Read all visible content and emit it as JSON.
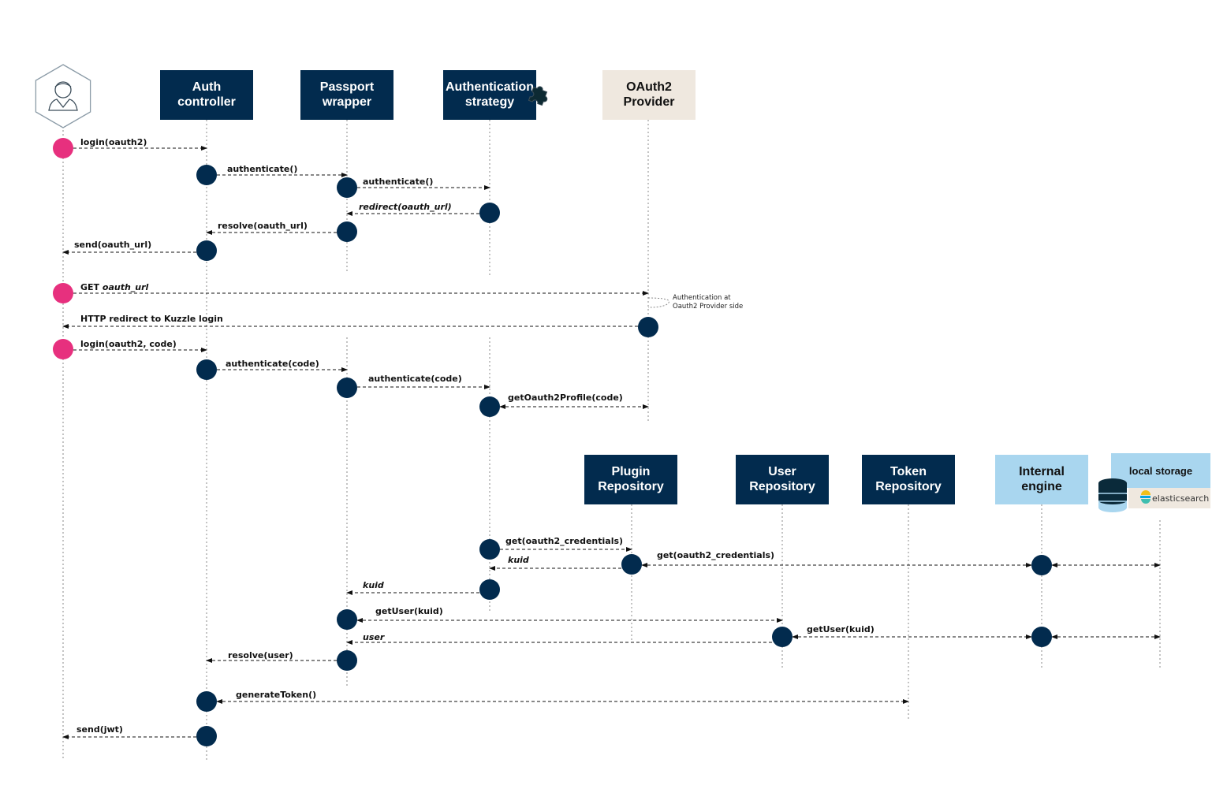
{
  "colors": {
    "navy": "#022b4e",
    "pink": "#e7307e",
    "beige": "#efe8df",
    "light_blue": "#a9d6ef",
    "line": "#888888",
    "arrow": "#111111"
  },
  "participants": [
    {
      "id": "user",
      "label": "",
      "icon": "user-avatar-icon",
      "style": "actor"
    },
    {
      "id": "auth_controller",
      "label": "Auth\ncontroller",
      "style": "navy"
    },
    {
      "id": "passport_wrapper",
      "label": "Passport\nwrapper",
      "style": "navy"
    },
    {
      "id": "auth_strategy",
      "label": "Authentication\nstrategy",
      "style": "navy",
      "icon": "puzzle-piece-icon"
    },
    {
      "id": "oauth2_provider",
      "label": "OAuth2\nProvider",
      "style": "beige"
    },
    {
      "id": "plugin_repository",
      "label": "Plugin\nRepository",
      "style": "navy"
    },
    {
      "id": "user_repository",
      "label": "User\nRepository",
      "style": "navy"
    },
    {
      "id": "token_repository",
      "label": "Token\nRepository",
      "style": "navy"
    },
    {
      "id": "internal_engine",
      "label": "Internal\nengine",
      "style": "light"
    },
    {
      "id": "local_storage",
      "label": "local storage",
      "style": "light",
      "sublabel": "elasticsearch",
      "icon": "database-icon"
    }
  ],
  "messages": [
    {
      "from": "user",
      "to": "auth_controller",
      "label": "login(oauth2)",
      "italic": false
    },
    {
      "from": "auth_controller",
      "to": "passport_wrapper",
      "label": "authenticate()",
      "italic": false
    },
    {
      "from": "passport_wrapper",
      "to": "auth_strategy",
      "label": "authenticate()",
      "italic": false
    },
    {
      "from": "auth_strategy",
      "to": "passport_wrapper",
      "label": "redirect(oauth_url)",
      "italic": true
    },
    {
      "from": "passport_wrapper",
      "to": "auth_controller",
      "label": "resolve(oauth_url)",
      "italic": false
    },
    {
      "from": "auth_controller",
      "to": "user",
      "label": "send(oauth_url)",
      "italic": false
    },
    {
      "from": "user",
      "to": "oauth2_provider",
      "label_prefix": "GET ",
      "label": "oauth_url",
      "italic": true
    },
    {
      "from": "oauth2_provider",
      "to": "user",
      "label": "HTTP redirect to Kuzzle login",
      "italic": false
    },
    {
      "from": "user",
      "to": "auth_controller",
      "label": "login(oauth2, code)",
      "italic": false
    },
    {
      "from": "auth_controller",
      "to": "passport_wrapper",
      "label": "authenticate(code)",
      "italic": false
    },
    {
      "from": "passport_wrapper",
      "to": "auth_strategy",
      "label": "authenticate(code)",
      "italic": false
    },
    {
      "from": "auth_strategy",
      "to": "oauth2_provider",
      "label": "getOauth2Profile(code)",
      "italic": false,
      "bidirectional": true
    },
    {
      "from": "auth_strategy",
      "to": "plugin_repository",
      "label": "get(oauth2_credentials)",
      "italic": false
    },
    {
      "from": "plugin_repository",
      "to": "internal_engine",
      "label": "get(oauth2_credentials)",
      "italic": false,
      "bidirectional": true
    },
    {
      "from": "internal_engine",
      "to": "local_storage",
      "label": "",
      "bidirectional": true
    },
    {
      "from": "plugin_repository",
      "to": "auth_strategy",
      "label": "kuid",
      "italic": true
    },
    {
      "from": "auth_strategy",
      "to": "passport_wrapper",
      "label": "kuid",
      "italic": true
    },
    {
      "from": "passport_wrapper",
      "to": "user_repository",
      "label": "getUser(kuid)",
      "italic": false,
      "bidirectional": true
    },
    {
      "from": "user_repository",
      "to": "passport_wrapper",
      "label": "user",
      "italic": true
    },
    {
      "from": "user_repository",
      "to": "internal_engine",
      "label": "getUser(kuid)",
      "italic": false,
      "bidirectional": true
    },
    {
      "from": "internal_engine",
      "to": "local_storage",
      "label": "",
      "bidirectional": true
    },
    {
      "from": "passport_wrapper",
      "to": "auth_controller",
      "label": "resolve(user)",
      "italic": false
    },
    {
      "from": "auth_controller",
      "to": "token_repository",
      "label": "generateToken()",
      "italic": false,
      "bidirectional": true
    },
    {
      "from": "auth_controller",
      "to": "user",
      "label": "send(jwt)",
      "italic": false
    }
  ],
  "notes": [
    {
      "at": "oauth2_provider",
      "text": "Authentication at\nOauth2 Provider side"
    }
  ]
}
